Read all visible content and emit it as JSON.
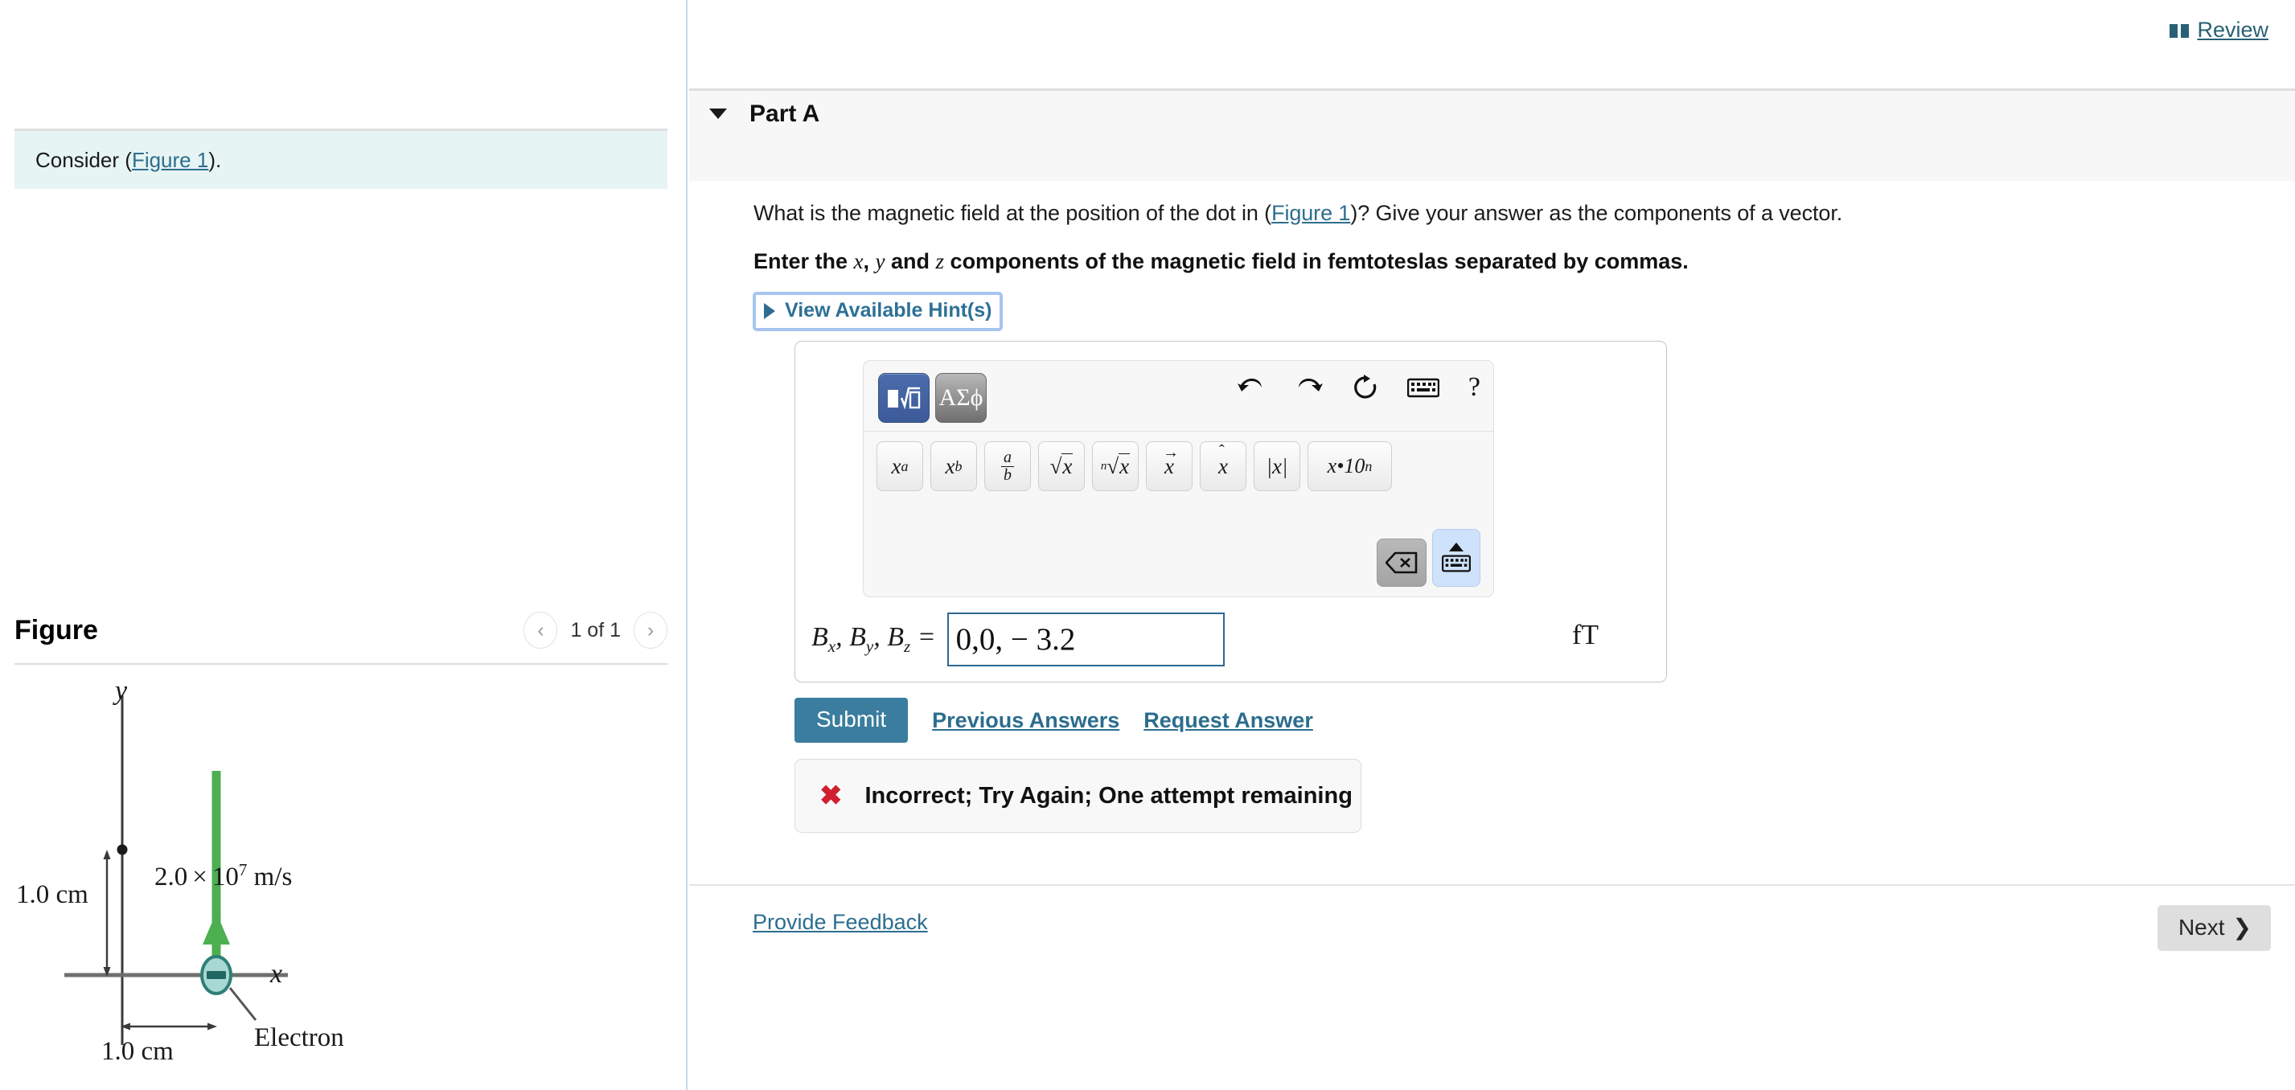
{
  "header": {
    "review_label": "Review",
    "book_icon": "book-icon"
  },
  "left": {
    "consider_prefix": "Consider (",
    "consider_link": "Figure 1",
    "consider_suffix": ").",
    "figure_title": "Figure",
    "pager": {
      "prev_icon": "‹",
      "next_icon": "›",
      "label": "1 of 1"
    }
  },
  "part": {
    "title": "Part A",
    "collapse_icon": "caret-down-icon"
  },
  "question": {
    "line1_a": "What is the magnetic field at the position of the dot in (",
    "line1_link": "Figure 1",
    "line1_b": ")? Give your answer as the components of a vector.",
    "instr_a": "Enter the ",
    "instr_x": "x",
    "instr_mid1": ", ",
    "instr_y": "y",
    "instr_mid2": " and ",
    "instr_z": "z",
    "instr_b": " components of the magnetic field in femtoteslas separated by commas.",
    "hint_label": "View Available Hint(s)"
  },
  "math_toolbar": {
    "mode_math": "math-template-icon",
    "mode_greek": "ΑΣϕ",
    "undo_icon": "undo-icon",
    "redo_icon": "redo-icon",
    "reset_icon": "reset-icon",
    "keyboard_icon": "keyboard-icon",
    "help_icon": "?",
    "templates": [
      {
        "name": "superscript",
        "label": "xᵃ"
      },
      {
        "name": "subscript",
        "label": "xb"
      },
      {
        "name": "fraction",
        "num": "a",
        "den": "b"
      },
      {
        "name": "square-root",
        "label": "√x"
      },
      {
        "name": "nth-root",
        "label": "ⁿ√x"
      },
      {
        "name": "vector",
        "label": "x⃗"
      },
      {
        "name": "unit-vector",
        "label": "x̂"
      },
      {
        "name": "absolute-value",
        "label": "|x|"
      },
      {
        "name": "scientific-notation",
        "label": "x•10ⁿ"
      }
    ],
    "backspace_icon": "backspace-icon",
    "hide-keyboard_icon": "hide-keyboard-icon"
  },
  "answer": {
    "label_bx": "B",
    "label_x": "x",
    "label_by": "B",
    "label_y": "y",
    "label_bz": "B",
    "label_z": "z",
    "equals": "=",
    "value": "0,0, − 3.2",
    "placeholder": "",
    "unit": "fT"
  },
  "actions": {
    "submit": "Submit",
    "previous_answers": "Previous Answers",
    "request_answer": "Request Answer"
  },
  "feedback": {
    "icon": "x-mark-icon",
    "message": "Incorrect; Try Again; One attempt remaining",
    "color": "#cf2030"
  },
  "footer": {
    "provide_feedback": "Provide Feedback",
    "next": "Next",
    "next_icon": "❯"
  },
  "figure_diagram": {
    "y_axis_label": "y",
    "x_axis_label": "x",
    "velocity_label_a": "2.0",
    "velocity_times": "×",
    "velocity_base": "10",
    "velocity_exp": "7",
    "velocity_units": "m/s",
    "vertical_distance": "1.0 cm",
    "horizontal_distance": "1.0 cm",
    "particle_label": "Electron",
    "particle_sign": "−",
    "arrow_color": "#4caf50",
    "particle_fill": "#a8d8d4",
    "particle_stroke": "#2f7f76"
  }
}
